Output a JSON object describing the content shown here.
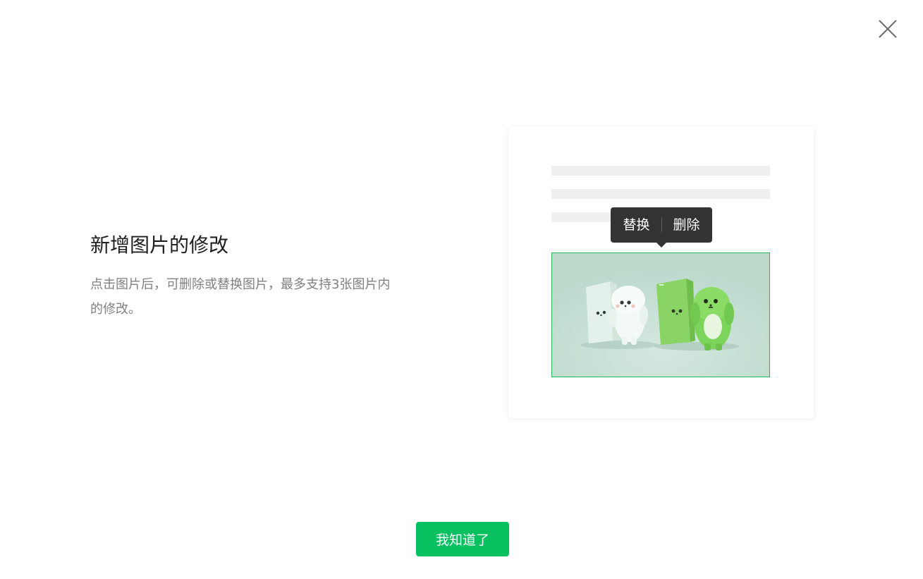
{
  "dialog": {
    "close_label": "×"
  },
  "info": {
    "title": "新增图片的修改",
    "description": "点击图片后，可删除或替换图片，最多支持3张图片内的修改。"
  },
  "preview": {
    "tooltip": {
      "replace_label": "替换",
      "delete_label": "删除"
    }
  },
  "footer": {
    "ok_label": "我知道了"
  },
  "colors": {
    "accent": "#07c160",
    "tooltip_bg": "#333333",
    "image_border": "#22b95a",
    "placeholder_line": "#efefef"
  },
  "icons": {
    "close": "close-icon"
  }
}
